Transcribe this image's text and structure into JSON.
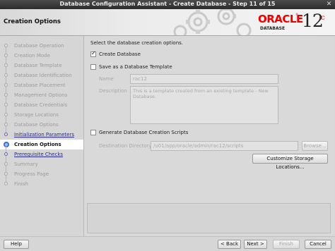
{
  "window": {
    "title": "Database Configuration Assistant - Create Database - Step 11 of 15",
    "close_glyph": "✕"
  },
  "header": {
    "page_title": "Creation Options",
    "oracle_word": "ORACLE",
    "oracle_reg": "®",
    "database_word": "DATABASE",
    "version": "12",
    "version_suffix": "c"
  },
  "steps": [
    {
      "label": "Database Operation",
      "state": "disabled"
    },
    {
      "label": "Creation Mode",
      "state": "disabled"
    },
    {
      "label": "Database Template",
      "state": "disabled"
    },
    {
      "label": "Database Identification",
      "state": "disabled"
    },
    {
      "label": "Database Placement",
      "state": "disabled"
    },
    {
      "label": "Management Options",
      "state": "disabled"
    },
    {
      "label": "Database Credentials",
      "state": "disabled"
    },
    {
      "label": "Storage Locations",
      "state": "disabled"
    },
    {
      "label": "Database Options",
      "state": "disabled"
    },
    {
      "label": "Initialization Parameters",
      "state": "link"
    },
    {
      "label": "Creation Options",
      "state": "active"
    },
    {
      "label": "Prerequisite Checks",
      "state": "link"
    },
    {
      "label": "Summary",
      "state": "disabled"
    },
    {
      "label": "Progress Page",
      "state": "disabled"
    },
    {
      "label": "Finish",
      "state": "disabled"
    }
  ],
  "form": {
    "intro": "Select the database creation options.",
    "create_db": {
      "label": "Create Database",
      "checked": true
    },
    "save_template": {
      "label": "Save as a Database Template",
      "checked": false
    },
    "name_label": "Name",
    "name_value": "rac12",
    "description_label": "Description",
    "description_value": "This is a template created from an existing template - New Database.",
    "gen_scripts": {
      "label": "Generate Database Creation Scripts",
      "checked": false
    },
    "dest_label": "Destination Directory:",
    "dest_value": "/u01/app/oracle/admin/rac12/scripts",
    "browse_label": "Browse...",
    "customize_label": "Customize Storage Locations..."
  },
  "footer": {
    "help": "Help",
    "back": "< Back",
    "next": "Next >",
    "finish": "Finish",
    "cancel": "Cancel"
  }
}
